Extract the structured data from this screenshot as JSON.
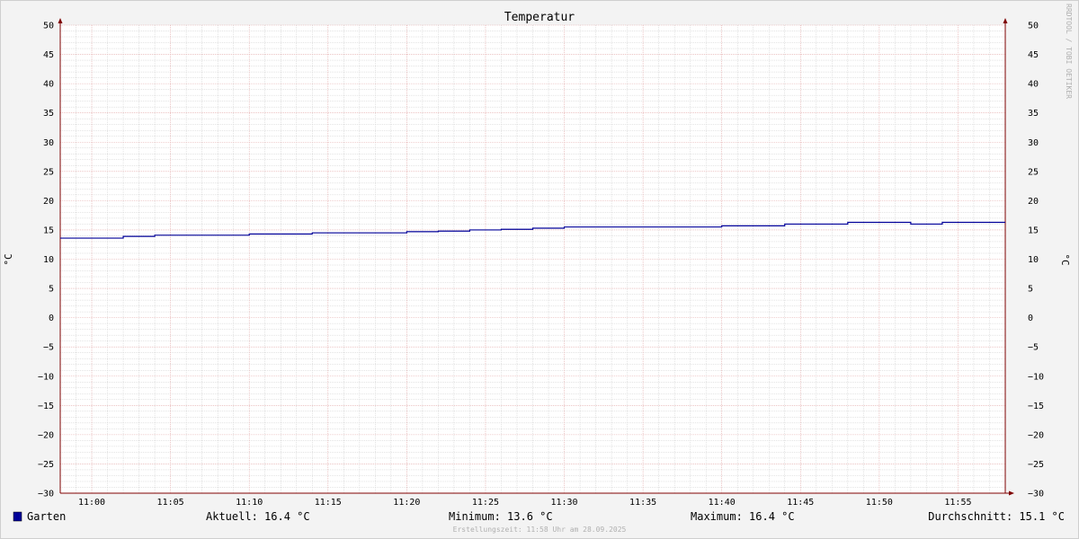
{
  "chart_data": {
    "type": "line",
    "title": "Temperatur",
    "ylabel": "°C",
    "ylim": [
      -30,
      50
    ],
    "y_ticks": [
      50,
      45,
      40,
      35,
      30,
      25,
      20,
      15,
      10,
      5,
      0,
      -5,
      -10,
      -15,
      -20,
      -25,
      -30
    ],
    "x_range": [
      "10:58",
      "11:58"
    ],
    "x_ticks": [
      "11:00",
      "11:05",
      "11:10",
      "11:15",
      "11:20",
      "11:25",
      "11:30",
      "11:35",
      "11:40",
      "11:45",
      "11:50",
      "11:55"
    ],
    "grid": true,
    "series": [
      {
        "name": "Garten",
        "color": "#000099",
        "step": true,
        "x": [
          "10:58",
          "11:02",
          "11:04",
          "11:08",
          "11:10",
          "11:14",
          "11:20",
          "11:22",
          "11:24",
          "11:26",
          "11:28",
          "11:30",
          "11:40",
          "11:44",
          "11:48",
          "11:52",
          "11:54",
          "11:58"
        ],
        "y": [
          13.6,
          13.9,
          14.1,
          14.1,
          14.3,
          14.5,
          14.7,
          14.8,
          15.0,
          15.1,
          15.3,
          15.5,
          15.7,
          16.0,
          16.3,
          16.0,
          16.3,
          16.3
        ]
      }
    ]
  },
  "legend": {
    "series_name": "Garten",
    "series_color": "#000099",
    "current": "Aktuell: 16.4 °C",
    "minimum": "Minimum: 13.6 °C",
    "maximum": "Maximum: 16.4 °C",
    "average": "Durchschnitt: 15.1 °C"
  },
  "footer": "Erstellungszeit: 11:58 Uhr am 28.09.2025",
  "watermark": "RRDTOOL / TOBI OETIKER",
  "colors": {
    "background": "#f3f3f3",
    "canvas": "#ffffff",
    "major_grid": "#e0a0a0",
    "minor_grid": "#c8c8c8",
    "axis": "#7f0000"
  }
}
